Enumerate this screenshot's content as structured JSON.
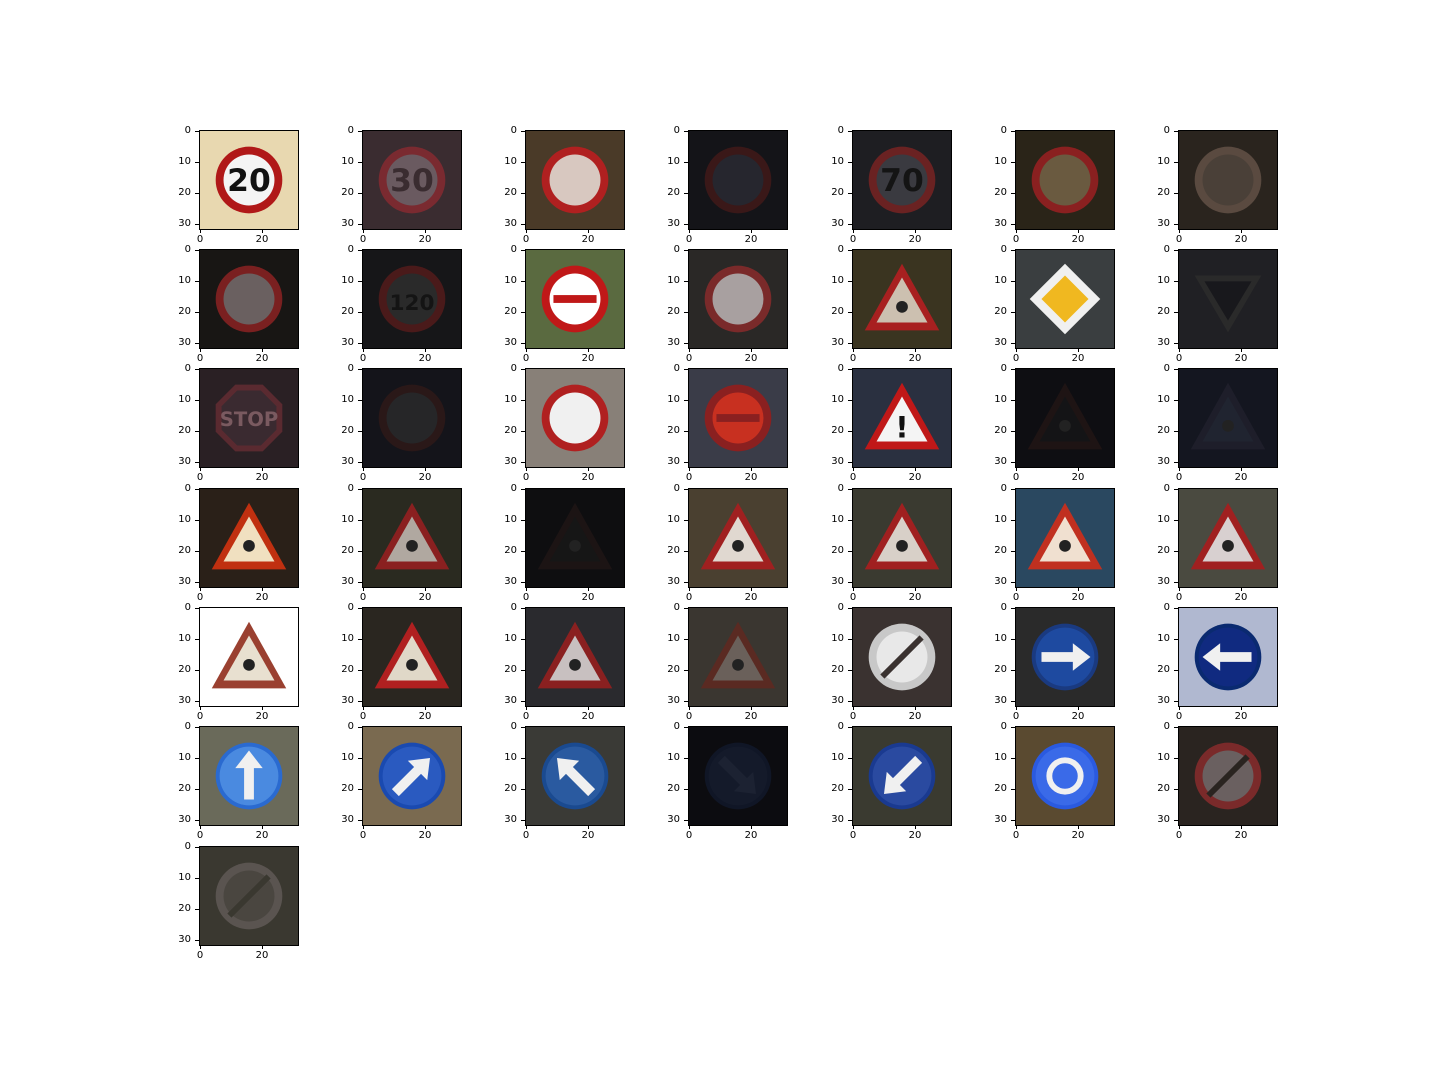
{
  "axes": {
    "y_ticks": [
      "0",
      "10",
      "20",
      "30"
    ],
    "x_ticks": [
      "0",
      "20"
    ]
  },
  "signs": [
    {
      "kind": "round",
      "bg": "#e8d8b0",
      "ring": "#b01818",
      "fill": "#f4f4f4",
      "text": "20",
      "textColor": "#111"
    },
    {
      "kind": "round",
      "bg": "#3a2c30",
      "ring": "#7a2a30",
      "fill": "#6a5a60",
      "text": "30",
      "textColor": "#3a2c30"
    },
    {
      "kind": "round",
      "bg": "#4a3a28",
      "ring": "#b02020",
      "fill": "#d8c8c0",
      "text": "",
      "textColor": "#111"
    },
    {
      "kind": "round",
      "bg": "#141418",
      "ring": "#3a1818",
      "fill": "#26262e",
      "text": "",
      "textColor": "#111"
    },
    {
      "kind": "round",
      "bg": "#1e1e22",
      "ring": "#6a2222",
      "fill": "#3a3a40",
      "text": "70",
      "textColor": "#141414"
    },
    {
      "kind": "round",
      "bg": "#2a2418",
      "ring": "#8a2020",
      "fill": "#6a5a40",
      "text": "",
      "textColor": "#111"
    },
    {
      "kind": "round",
      "bg": "#2a241e",
      "ring": "#5a4a40",
      "fill": "#4a4038",
      "text": "",
      "textColor": "#111"
    },
    {
      "kind": "round",
      "bg": "#181614",
      "ring": "#7a2020",
      "fill": "#6a6060",
      "text": "",
      "textColor": "#111"
    },
    {
      "kind": "round",
      "bg": "#161618",
      "ring": "#4a1a1a",
      "fill": "#2a2a2a",
      "text": "120",
      "textColor": "#141414"
    },
    {
      "kind": "noentry",
      "bg": "#5a6a40",
      "ring": "#c01818",
      "fill": "#ffffff",
      "text": "",
      "textColor": "#111"
    },
    {
      "kind": "round",
      "bg": "#2a2826",
      "ring": "#7a2a2a",
      "fill": "#a8a0a0",
      "text": "",
      "textColor": "#111"
    },
    {
      "kind": "triangle",
      "bg": "#3a3420",
      "ring": "#a82020",
      "fill": "#ccc0b0",
      "text": "",
      "textColor": "#111"
    },
    {
      "kind": "diamond",
      "bg": "#3a3e40",
      "ring": "#f0f0f0",
      "fill": "#f0b820",
      "text": "",
      "textColor": "#111"
    },
    {
      "kind": "yield",
      "bg": "#202024",
      "ring": "#2a2a2a",
      "fill": "#18181c",
      "text": "",
      "textColor": "#111"
    },
    {
      "kind": "stop",
      "bg": "#2a2024",
      "ring": "#5a2a30",
      "fill": "#3a2a30",
      "text": "STOP",
      "textColor": "#7a5a60"
    },
    {
      "kind": "round",
      "bg": "#14141a",
      "ring": "#2a1818",
      "fill": "#262628",
      "text": "",
      "textColor": "#111"
    },
    {
      "kind": "round",
      "bg": "#888078",
      "ring": "#b02020",
      "fill": "#f0f0f0",
      "text": "",
      "textColor": "#111"
    },
    {
      "kind": "noentry",
      "bg": "#3a3c48",
      "ring": "#8a2020",
      "fill": "#c83020",
      "text": "",
      "textColor": "#111"
    },
    {
      "kind": "triangle",
      "bg": "#2a3040",
      "ring": "#c01818",
      "fill": "#f4f4f4",
      "text": "!",
      "textColor": "#111"
    },
    {
      "kind": "triangle",
      "bg": "#0e0e12",
      "ring": "#1e1414",
      "fill": "#141416",
      "text": "",
      "textColor": "#111"
    },
    {
      "kind": "triangle",
      "bg": "#141620",
      "ring": "#1e1e2a",
      "fill": "#202430",
      "text": "",
      "textColor": "#111"
    },
    {
      "kind": "triangle",
      "bg": "#2a2018",
      "ring": "#c03010",
      "fill": "#f0e0c0",
      "text": "",
      "textColor": "#111"
    },
    {
      "kind": "triangle",
      "bg": "#2a2a20",
      "ring": "#8a2020",
      "fill": "#b0a8a0",
      "text": "",
      "textColor": "#111"
    },
    {
      "kind": "triangle",
      "bg": "#0e0e10",
      "ring": "#1c1414",
      "fill": "#161616",
      "text": "",
      "textColor": "#111"
    },
    {
      "kind": "triangle",
      "bg": "#4a4030",
      "ring": "#a02020",
      "fill": "#e0d8d0",
      "text": "",
      "textColor": "#111"
    },
    {
      "kind": "triangle",
      "bg": "#3a3a30",
      "ring": "#a02020",
      "fill": "#d8d0c8",
      "text": "",
      "textColor": "#111"
    },
    {
      "kind": "triangle",
      "bg": "#2a4860",
      "ring": "#c03020",
      "fill": "#f0e0d0",
      "text": "",
      "textColor": "#111"
    },
    {
      "kind": "triangle",
      "bg": "#4a4a40",
      "ring": "#a02020",
      "fill": "#d8d0d0",
      "text": "",
      "textColor": "#111"
    },
    {
      "kind": "triangle",
      "bg": "#ffffff",
      "ring": "#9a4030",
      "fill": "#e8e0d0",
      "text": "",
      "textColor": "#111"
    },
    {
      "kind": "triangle",
      "bg": "#2a2620",
      "ring": "#b02020",
      "fill": "#e0d8c8",
      "text": "",
      "textColor": "#111"
    },
    {
      "kind": "triangle",
      "bg": "#2a2a2e",
      "ring": "#8a2020",
      "fill": "#c8c0c0",
      "text": "",
      "textColor": "#111"
    },
    {
      "kind": "triangle",
      "bg": "#3a3630",
      "ring": "#5a2a22",
      "fill": "#6a605a",
      "text": "",
      "textColor": "#111"
    },
    {
      "kind": "derestrict",
      "bg": "#3a3230",
      "ring": "#c8c8c8",
      "fill": "#e8e8e8",
      "text": "",
      "textColor": "#111"
    },
    {
      "kind": "arrow",
      "bg": "#2a2a2a",
      "ring": "#1a3a80",
      "fill": "#1e4aa0",
      "text": "",
      "textColor": "#111",
      "dir": "right"
    },
    {
      "kind": "arrow",
      "bg": "#b0b8d0",
      "ring": "#0a2a70",
      "fill": "#102a80",
      "text": "",
      "textColor": "#111",
      "dir": "left"
    },
    {
      "kind": "arrow",
      "bg": "#6a6a5a",
      "ring": "#2a6ad0",
      "fill": "#4a8ae0",
      "text": "",
      "textColor": "#111",
      "dir": "up"
    },
    {
      "kind": "arrow",
      "bg": "#7a6a50",
      "ring": "#1a4ab0",
      "fill": "#2a5ac0",
      "text": "",
      "textColor": "#111",
      "dir": "upright"
    },
    {
      "kind": "arrow",
      "bg": "#3a3a36",
      "ring": "#1a4a90",
      "fill": "#2a5aa0",
      "text": "",
      "textColor": "#111",
      "dir": "upleft"
    },
    {
      "kind": "arrow",
      "bg": "#0c0c10",
      "ring": "#101626",
      "fill": "#141a2a",
      "text": "",
      "textColor": "#111",
      "dir": "downright"
    },
    {
      "kind": "arrow",
      "bg": "#3a3a30",
      "ring": "#1a3a90",
      "fill": "#2a4aa0",
      "text": "",
      "textColor": "#111",
      "dir": "downleft"
    },
    {
      "kind": "roundabout",
      "bg": "#5a4a30",
      "ring": "#2a5ae0",
      "fill": "#3a6ae8",
      "text": "",
      "textColor": "#111"
    },
    {
      "kind": "derestrict",
      "bg": "#2a2420",
      "ring": "#7a2a2a",
      "fill": "#6a6060",
      "text": "",
      "textColor": "#111"
    },
    {
      "kind": "derestrict",
      "bg": "#3a3830",
      "ring": "#5a5450",
      "fill": "#4a4640",
      "text": "",
      "textColor": "#111"
    }
  ]
}
